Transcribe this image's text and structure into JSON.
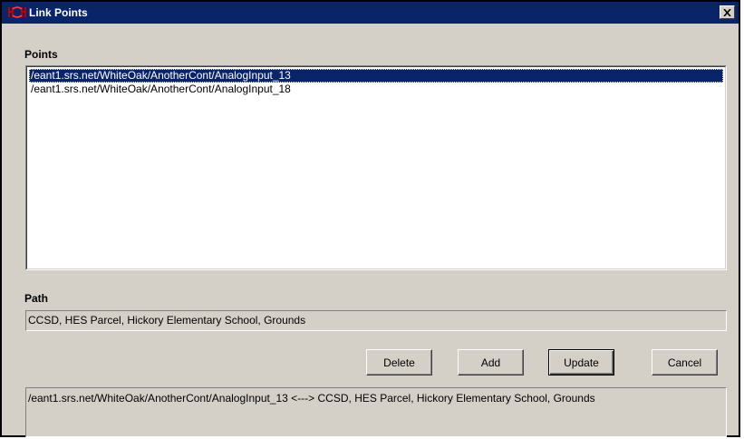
{
  "window": {
    "title": "Link Points",
    "close_glyph": "✕"
  },
  "points": {
    "label": "Points",
    "items": [
      {
        "text": "/eant1.srs.net/WhiteOak/AnotherCont/AnalogInput_13",
        "selected": true
      },
      {
        "text": "/eant1.srs.net/WhiteOak/AnotherCont/AnalogInput_18",
        "selected": false
      }
    ]
  },
  "path": {
    "label": "Path",
    "value": "CCSD, HES Parcel, Hickory Elementary School, Grounds"
  },
  "buttons": {
    "delete": "Delete",
    "add": "Add",
    "update": "Update",
    "cancel": "Cancel"
  },
  "link_summary": {
    "value": "/eant1.srs.net/WhiteOak/AnotherCont/AnalogInput_13 <---> CCSD, HES Parcel, Hickory Elementary School, Grounds"
  },
  "colors": {
    "titlebar": "#0a246a",
    "face": "#d4d0c8",
    "selection": "#0a246a"
  }
}
